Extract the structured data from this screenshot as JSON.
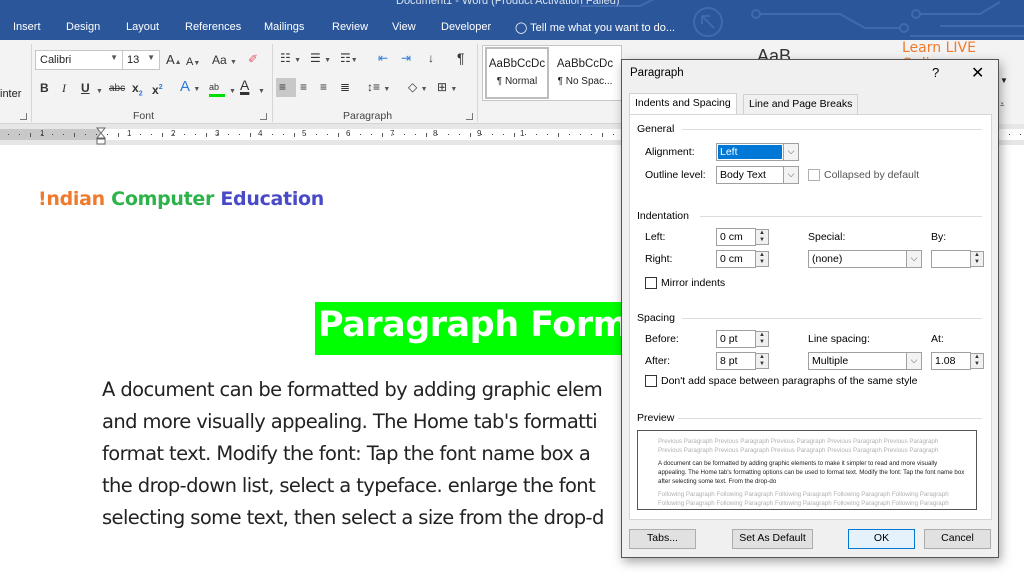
{
  "window": {
    "title": "Document1 - Word (Product Activation Failed)"
  },
  "ribbon_tabs": [
    "Insert",
    "Design",
    "Layout",
    "References",
    "Mailings",
    "Review",
    "View",
    "Developer"
  ],
  "tell_me": "Tell me what you want to do...",
  "clipboard": {
    "format_painter_fragment": "inter"
  },
  "font_group": {
    "label": "Font",
    "font_name": "Calibri",
    "font_size": "13",
    "grow_font": "A",
    "shrink_font": "A",
    "change_case": "Aa",
    "bold": "B",
    "italic": "I",
    "underline": "U",
    "strikethrough": "abc",
    "subscript": "x",
    "superscript": "x",
    "text_effects": "A",
    "highlight": "ab",
    "font_color": "A",
    "highlight_color": "#00e000",
    "font_color_value": "#000000"
  },
  "paragraph_group": {
    "label": "Paragraph",
    "show_marks": "¶"
  },
  "styles": [
    {
      "preview": "AaBbCcDc",
      "name": "¶ Normal",
      "selected": true
    },
    {
      "preview": "AaBbCcDc",
      "name": "¶ No Spac..."
    },
    {
      "preview": "AaB"
    }
  ],
  "watermark": "Learn LIVE Online",
  "ruler": {
    "labels_left": [
      "1"
    ],
    "labels_right": [
      "1",
      "2",
      "3",
      "4",
      "5",
      "6",
      "7",
      "8",
      "9",
      "1"
    ]
  },
  "document": {
    "brand": [
      {
        "text": "!ndian ",
        "color": "#f07a2c"
      },
      {
        "text": "Computer ",
        "color": "#2db34a"
      },
      {
        "text": "Education",
        "color": "#4a4ac8"
      }
    ],
    "heading": "Paragraph Forma",
    "heading_bg": "#00ff00",
    "lines": [
      "A document can be formatted by adding graphic elem",
      "and more visually appealing. The Home tab's formatti",
      "format text. Modify the font: Tap the font name box a",
      "the drop-down list, select a typeface. enlarge the font",
      "selecting some text, then select a size from the drop-d"
    ]
  },
  "dialog": {
    "title": "Paragraph",
    "help": "?",
    "close": "✕",
    "tabs": [
      "Indents and Spacing",
      "Line and Page Breaks"
    ],
    "general": {
      "heading": "General",
      "alignment_label": "Alignment:",
      "alignment_value": "Left",
      "outline_label": "Outline level:",
      "outline_value": "Body Text",
      "collapsed_label": "Collapsed by default",
      "collapsed_checked": false
    },
    "indentation": {
      "heading": "Indentation",
      "left_label": "Left:",
      "left_value": "0 cm",
      "right_label": "Right:",
      "right_value": "0 cm",
      "special_label": "Special:",
      "special_value": "(none)",
      "by_label": "By:",
      "by_value": "",
      "mirror_label": "Mirror indents",
      "mirror_checked": false
    },
    "spacing": {
      "heading": "Spacing",
      "before_label": "Before:",
      "before_value": "0 pt",
      "after_label": "After:",
      "after_value": "8 pt",
      "line_spacing_label": "Line spacing:",
      "line_spacing_value": "Multiple",
      "at_label": "At:",
      "at_value": "1.08",
      "dont_add_label": "Don't add space between paragraphs of the same style",
      "dont_add_checked": false
    },
    "preview": {
      "heading": "Preview",
      "previous": [
        "Previous Paragraph Previous Paragraph Previous Paragraph Previous Paragraph Previous Paragraph",
        "Previous Paragraph Previous Paragraph Previous Paragraph Previous Paragraph Previous Paragraph"
      ],
      "current": "A document can be formatted by adding graphic elements to make it simpler to read and more visually appealing. The Home tab's formatting options can be used to format text. Modify the font: Tap the font name box after selecting some text. From the drop-do",
      "following": [
        "Following Paragraph Following Paragraph Following Paragraph Following Paragraph Following Paragraph",
        "Following Paragraph Following Paragraph Following Paragraph Following Paragraph Following Paragraph"
      ]
    },
    "buttons": {
      "tabs": "Tabs...",
      "set_default": "Set As Default",
      "ok": "OK",
      "cancel": "Cancel"
    }
  }
}
